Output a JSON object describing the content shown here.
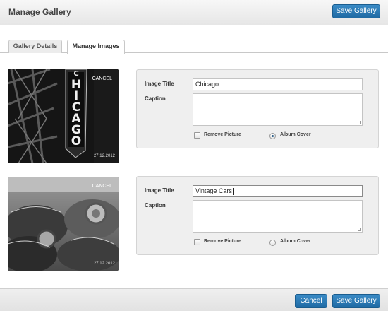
{
  "header": {
    "title": "Manage Gallery",
    "save_label": "Save Gallery"
  },
  "tabs": [
    {
      "label": "Gallery Details",
      "active": false
    },
    {
      "label": "Manage Images",
      "active": true
    }
  ],
  "images": [
    {
      "cancel_label": "CANCEL",
      "date": "27.12.2012",
      "sign_letters": [
        "H",
        "I",
        "C",
        "A",
        "G",
        "O"
      ],
      "sign_top_letters": [
        "C"
      ],
      "fields": {
        "title_label": "Image Title",
        "title_value": "Chicago",
        "caption_label": "Caption",
        "caption_value": "",
        "remove_label": "Remove Picture",
        "remove_checked": false,
        "cover_label": "Album Cover",
        "cover_selected": true
      }
    },
    {
      "cancel_label": "CANCEL",
      "date": "27.12.2012",
      "fields": {
        "title_label": "Image Title",
        "title_value": "Vintage Cars",
        "caption_label": "Caption",
        "caption_value": "",
        "remove_label": "Remove Picture",
        "remove_checked": false,
        "cover_label": "Album Cover",
        "cover_selected": false
      }
    }
  ],
  "footer": {
    "cancel_label": "Cancel",
    "save_label": "Save Gallery"
  },
  "colors": {
    "button": "#2478b5",
    "panel": "#efefef",
    "header": "#ececec"
  }
}
